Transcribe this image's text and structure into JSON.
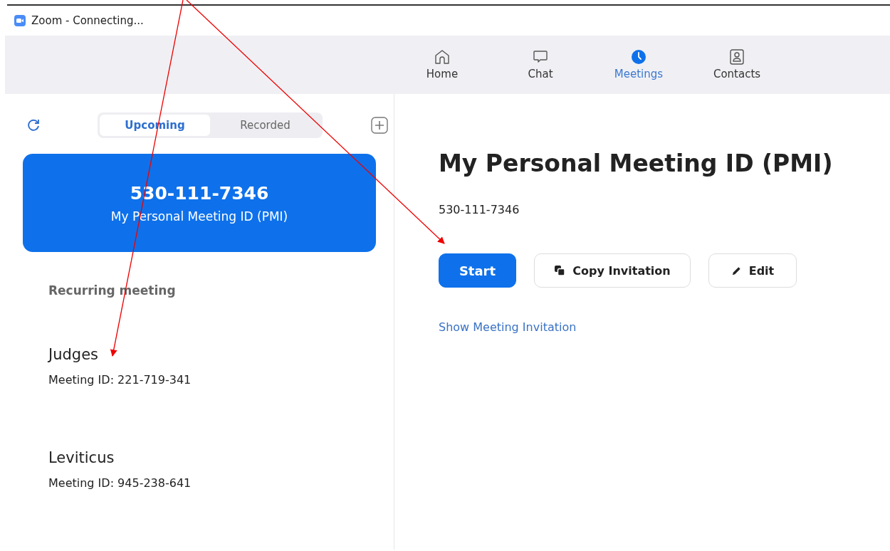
{
  "window": {
    "title": "Zoom - Connecting..."
  },
  "nav_tabs": [
    {
      "label": "Home",
      "kind": "home",
      "selected": false
    },
    {
      "label": "Chat",
      "kind": "chat",
      "selected": false
    },
    {
      "label": "Meetings",
      "kind": "meetings",
      "selected": true
    },
    {
      "label": "Contacts",
      "kind": "contacts",
      "selected": false
    }
  ],
  "segments": [
    {
      "label": "Upcoming",
      "selected": true
    },
    {
      "label": "Recorded",
      "selected": false
    }
  ],
  "pmi_card": {
    "number": "530-111-7346",
    "caption": "My Personal Meeting ID (PMI)"
  },
  "section_heading": "Recurring meeting",
  "meetings": [
    {
      "name": "Judges",
      "meeting_id": "Meeting ID: 221-719-341"
    },
    {
      "name": "Leviticus",
      "meeting_id": "Meeting ID: 945-238-641"
    }
  ],
  "detail": {
    "title": "My Personal Meeting ID (PMI)",
    "meeting_id": "530-111-7346",
    "buttons": [
      {
        "label": "Start",
        "kind": "primary"
      },
      {
        "label": "Copy Invitation",
        "kind": "copy"
      },
      {
        "label": "Edit",
        "kind": "edit"
      }
    ],
    "link": "Show Meeting Invitation"
  }
}
